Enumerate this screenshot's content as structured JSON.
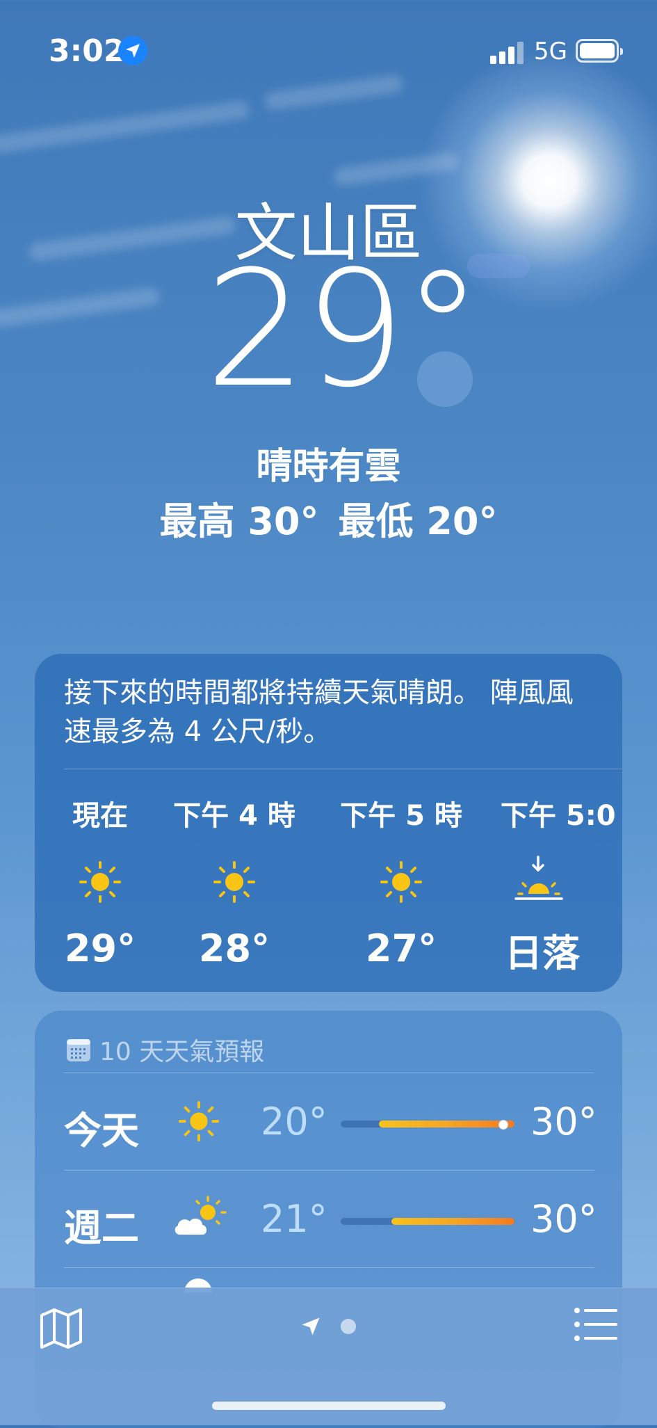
{
  "status_bar": {
    "time": "3:02",
    "network": "5G",
    "battery_level": 1.0,
    "location_icon": "location-arrow-icon"
  },
  "current": {
    "location": "文山區",
    "temperature": "29°",
    "condition": "晴時有雲",
    "high": "最高 30°",
    "low": "最低 20°"
  },
  "hourly_card": {
    "summary": "接下來的時間都將持續天氣晴朗。 陣風風速最多為 4 公尺/秒。",
    "hours": [
      {
        "label": "現在",
        "icon": "sun-icon",
        "temp": "29°"
      },
      {
        "label": "下午 4 時",
        "icon": "sun-icon",
        "temp": "28°"
      },
      {
        "label": "下午 5 時",
        "icon": "sun-icon",
        "temp": "27°"
      },
      {
        "label": "下午 5:0",
        "icon": "sunset-icon",
        "temp": "日落"
      }
    ]
  },
  "forecast_card": {
    "title": "10 天天氣預報",
    "days": [
      {
        "day": "今天",
        "icon": "sun-icon",
        "low": "20°",
        "high": "30°",
        "range_start": 0.22,
        "range_end": 1.0,
        "current_marker": 0.93
      },
      {
        "day": "週二",
        "icon": "partly-cloudy-icon",
        "low": "21°",
        "high": "30°",
        "range_start": 0.29,
        "range_end": 1.0
      }
    ]
  },
  "toolbar": {
    "map_icon": "map-icon",
    "location_icon": "location-arrow-icon",
    "list_icon": "list-icon"
  },
  "colors": {
    "sun": "#f8c514",
    "bar_start": "#f7c21a",
    "bar_end": "#f57a20",
    "badge_blue": "#1a84ff"
  }
}
